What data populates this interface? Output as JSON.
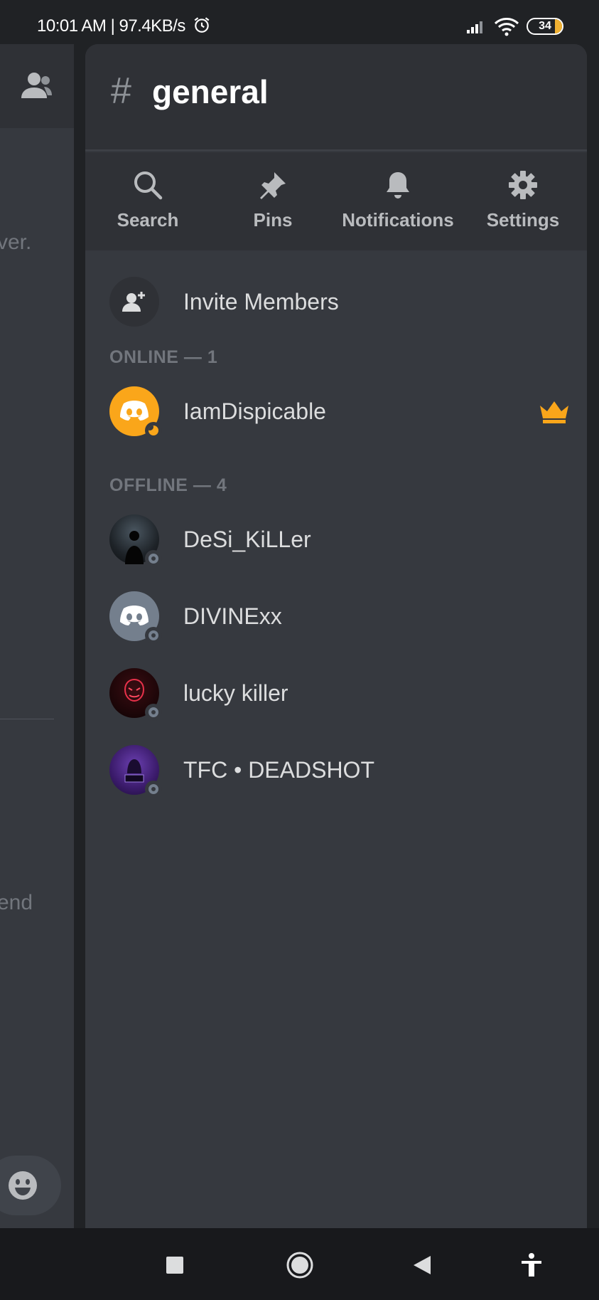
{
  "status_bar": {
    "time": "10:01 AM | 97.4KB/s",
    "battery": "34"
  },
  "background": {
    "partial_text_1": "ver.",
    "partial_text_2": "end"
  },
  "channel": {
    "hash": "#",
    "name": "general"
  },
  "actions": [
    {
      "label": "Search",
      "icon": "search-icon"
    },
    {
      "label": "Pins",
      "icon": "pin-icon"
    },
    {
      "label": "Notifications",
      "icon": "bell-icon"
    },
    {
      "label": "Settings",
      "icon": "gear-icon"
    }
  ],
  "invite": {
    "label": "Invite Members"
  },
  "sections": {
    "online": "ONLINE — 1",
    "offline": "OFFLINE — 4"
  },
  "members": {
    "online": [
      {
        "name": "IamDispicable",
        "status": "idle",
        "owner": true,
        "avatar_color": "#faa61a"
      }
    ],
    "offline": [
      {
        "name": "DeSi_KiLLer",
        "status": "offline",
        "avatar_color": "#1a1d21"
      },
      {
        "name": "DIVINExx",
        "status": "offline",
        "avatar_color": "#747f8d"
      },
      {
        "name": "lucky killer",
        "status": "offline",
        "avatar_color": "#2a0d10"
      },
      {
        "name": "TFC • DEADSHOT",
        "status": "offline",
        "avatar_color": "#3b1b6b"
      }
    ]
  },
  "colors": {
    "accent_owner": "#faa61a",
    "background": "#36393f",
    "header": "#2f3136"
  }
}
